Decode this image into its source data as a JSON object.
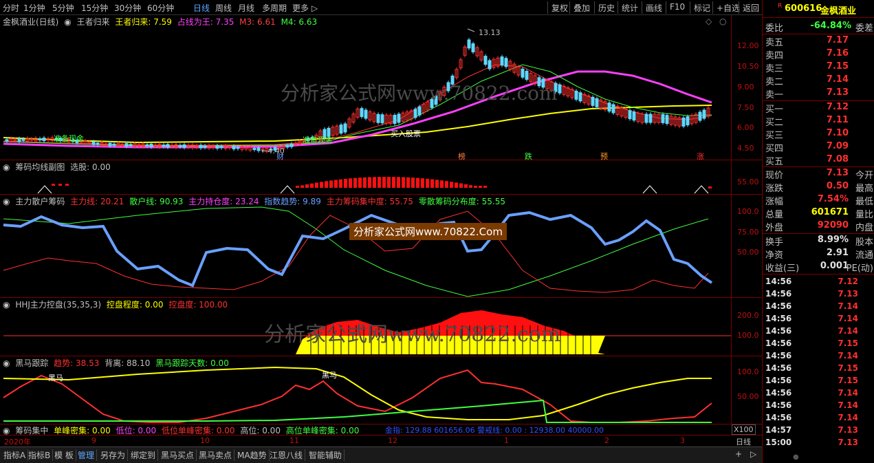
{
  "toolbar": {
    "periods": [
      "分时",
      "1分钟",
      "5分钟",
      "15分钟",
      "30分钟",
      "60分钟",
      "日线",
      "周线",
      "月线",
      "多周期",
      "更多 ▷"
    ],
    "active": "日线",
    "right": [
      "复权",
      "叠加",
      "历史",
      "统计",
      "画线",
      "F10",
      "标记",
      "+自选",
      "返回"
    ]
  },
  "stock": {
    "code": "600616",
    "name": "金枫酒业",
    "flag": "R"
  },
  "main": {
    "title": "金枫酒业(日线)",
    "indicator": "王者归来",
    "items": [
      {
        "label": "王者归来: 7.59",
        "color": "#ffff00"
      },
      {
        "label": "占线为王: 7.35",
        "color": "#ff40ff"
      },
      {
        "label": "M3: 6.61",
        "color": "#ff4040"
      },
      {
        "label": "M4: 6.63",
        "color": "#40ff40"
      }
    ],
    "ticks": [
      "12.00",
      "10.50",
      "9.00",
      "7.50",
      "6.00",
      "4.50"
    ],
    "high": "13.13",
    "low": "4.40",
    "texts": [
      "准备现金",
      "准备现金",
      "买入股票"
    ],
    "markers": [
      "财",
      "榜",
      "跌",
      "预",
      "涨"
    ]
  },
  "p1": {
    "title": "筹码均线副图",
    "items": [
      {
        "label": "选股: 0.00",
        "color": "#c0c0c0"
      }
    ],
    "ticks": [
      "55.00"
    ]
  },
  "p2": {
    "title": "主力散户筹码",
    "items": [
      {
        "label": "主力线: 20.21",
        "color": "#ff3030"
      },
      {
        "label": "散户线: 90.93",
        "color": "#40ff40"
      },
      {
        "label": "主力持仓度: 23.24",
        "color": "#ff40ff"
      },
      {
        "label": "指数趋势: 9.89",
        "color": "#6aa0ff"
      },
      {
        "label": "主力筹码集中度: 55.75",
        "color": "#ff3030"
      },
      {
        "label": "零散筹码分布度: 55.55",
        "color": "#40ff40"
      }
    ],
    "ticks": [
      "100.0",
      "75.00",
      "50.00"
    ],
    "watermark": "分析家公式网www.70822.Com"
  },
  "p3": {
    "title": "HHJ主力控盘(35,35,3)",
    "items": [
      {
        "label": "控盘程度: 0.00",
        "color": "#ffff00"
      },
      {
        "label": "控盘度: 100.00",
        "color": "#ff3030"
      }
    ],
    "ticks": [
      "200.0",
      "100.0"
    ]
  },
  "p4": {
    "title": "黑马跟踪",
    "items": [
      {
        "label": "趋势: 38.53",
        "color": "#ff3030"
      },
      {
        "label": "背离: 88.10",
        "color": "#c0c0c0"
      },
      {
        "label": "黑马跟踪天数: 0.00",
        "color": "#40ff40"
      }
    ],
    "ticks": [
      "100.0",
      "50.00"
    ],
    "texts": [
      "黑马",
      "黑马"
    ]
  },
  "p5": {
    "title": "筹码集中",
    "items": [
      {
        "label": "单峰密集: 0.00",
        "color": "#ffff00"
      },
      {
        "label": "低位: 0.00",
        "color": "#ff40ff"
      },
      {
        "label": "低位单峰密集: 0.00",
        "color": "#ff3030"
      },
      {
        "label": "高位: 0.00",
        "color": "#c0c0c0"
      },
      {
        "label": "高位单峰密集: 0.00",
        "color": "#40ff40"
      }
    ],
    "extra": "金指: 129.88   601656.06  警戒线: 0.00 : 12938.00   40000.00",
    "scale": "X100"
  },
  "dates": [
    "2020年",
    "9",
    "10",
    "11",
    "12",
    "1",
    "2",
    "3"
  ],
  "period_label": "日线",
  "watermark": "分析家公式网www.70822.com",
  "quote": {
    "weibi": {
      "label": "委比",
      "value": "-64.84%",
      "right": "委差"
    },
    "asks": [
      {
        "label": "卖五",
        "price": "7.17"
      },
      {
        "label": "卖四",
        "price": "7.16"
      },
      {
        "label": "卖三",
        "price": "7.15"
      },
      {
        "label": "卖二",
        "price": "7.14"
      },
      {
        "label": "卖一",
        "price": "7.13"
      }
    ],
    "bids": [
      {
        "label": "买一",
        "price": "7.12"
      },
      {
        "label": "买二",
        "price": "7.11"
      },
      {
        "label": "买三",
        "price": "7.10"
      },
      {
        "label": "买四",
        "price": "7.09"
      },
      {
        "label": "买五",
        "price": "7.08"
      }
    ],
    "stats": [
      {
        "label": "现价",
        "value": "7.13",
        "right": "今开",
        "color": "#ff3030"
      },
      {
        "label": "涨跌",
        "value": "0.50",
        "right": "最高",
        "color": "#ff3030"
      },
      {
        "label": "涨幅",
        "value": "7.54%",
        "right": "最低",
        "color": "#ff3030"
      },
      {
        "label": "总量",
        "value": "601671",
        "right": "量比",
        "color": "#ffff00"
      },
      {
        "label": "外盘",
        "value": "92090",
        "right": "内盘",
        "color": "#ff3030"
      }
    ],
    "stats2": [
      {
        "label": "换手",
        "value": "8.99%",
        "right": "股本",
        "color": "#e0e0e0"
      },
      {
        "label": "净资",
        "value": "2.91",
        "right": "流通",
        "color": "#e0e0e0"
      },
      {
        "label": "收益(三)",
        "value": "0.001",
        "right": "PE(动)",
        "color": "#e0e0e0"
      }
    ],
    "ticks": [
      {
        "time": "14:56",
        "price": "7.12"
      },
      {
        "time": "14:56",
        "price": "7.13"
      },
      {
        "time": "14:56",
        "price": "7.14"
      },
      {
        "time": "14:56",
        "price": "7.14"
      },
      {
        "time": "14:56",
        "price": "7.14"
      },
      {
        "time": "14:56",
        "price": "7.15"
      },
      {
        "time": "14:56",
        "price": "7.14"
      },
      {
        "time": "14:56",
        "price": "7.15"
      },
      {
        "time": "14:56",
        "price": "7.15"
      },
      {
        "time": "14:56",
        "price": "7.14"
      },
      {
        "time": "14:56",
        "price": "7.14"
      },
      {
        "time": "14:56",
        "price": "7.14"
      },
      {
        "time": "14:57",
        "price": "7.13"
      },
      {
        "time": "15:00",
        "price": "7.13"
      }
    ]
  },
  "bottom": {
    "tabs": [
      "指标A",
      "指标B",
      "模 板",
      "管理",
      "另存为",
      "绑定到",
      "黑马买点",
      "黑马卖点",
      "MA趋势",
      "江恩八线",
      "智能辅助"
    ],
    "active": "管理",
    "right": [
      "+",
      "▷"
    ]
  }
}
